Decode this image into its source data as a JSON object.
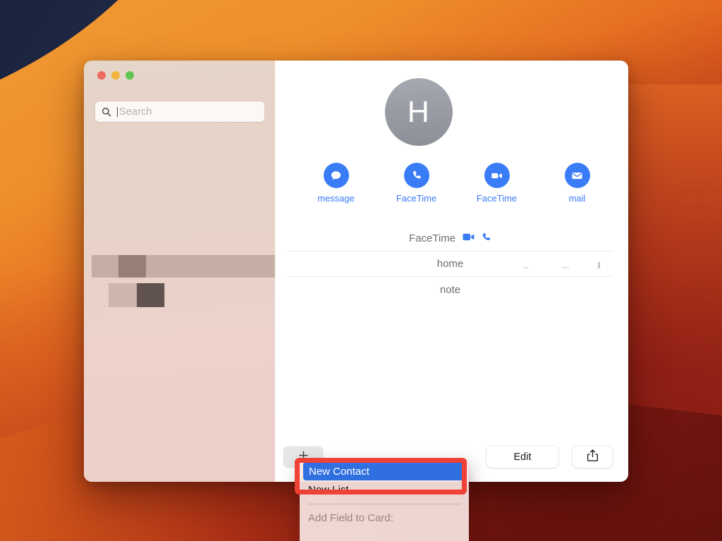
{
  "desktop": {
    "wallpaper_name": "ventura-orange-swirl"
  },
  "window": {
    "app": "Contacts",
    "traffic_lights": [
      {
        "name": "close",
        "color": "#ec6a5e"
      },
      {
        "name": "minimize",
        "color": "#f2b33f"
      },
      {
        "name": "zoom",
        "color": "#61c554"
      }
    ]
  },
  "sidebar": {
    "search": {
      "placeholder": "Search",
      "value": "",
      "icon": "search-icon",
      "focused": true
    },
    "redacted_rows": 2
  },
  "contact": {
    "avatar": {
      "initial": "H",
      "icon": "avatar-monogram"
    },
    "actions": [
      {
        "label": "message",
        "icon": "message-bubble-icon",
        "color": "#3a7cf6"
      },
      {
        "label": "FaceTime",
        "icon": "phone-handset-icon",
        "color": "#3a7cf6"
      },
      {
        "label": "FaceTime",
        "icon": "video-camera-icon",
        "color": "#3a7cf6"
      },
      {
        "label": "mail",
        "icon": "envelope-icon",
        "color": "#3a7cf6"
      }
    ],
    "fields": [
      {
        "label": "FaceTime",
        "icons": [
          "video-camera-icon",
          "phone-handset-icon"
        ]
      },
      {
        "label": "home",
        "icons": []
      },
      {
        "label": "note",
        "icons": []
      }
    ]
  },
  "toolbar": {
    "add_label": "+",
    "add_icon": "plus-icon",
    "edit_label": "Edit",
    "share_icon": "share-icon"
  },
  "popup_menu": {
    "items": [
      {
        "label": "New Contact",
        "selected": true
      },
      {
        "label": "New List",
        "selected": false
      }
    ],
    "section_label": "Add Field to Card:",
    "highlight_color": "#2f6fe0"
  },
  "annotation": {
    "target": "New Contact",
    "color": "#ef4136"
  }
}
